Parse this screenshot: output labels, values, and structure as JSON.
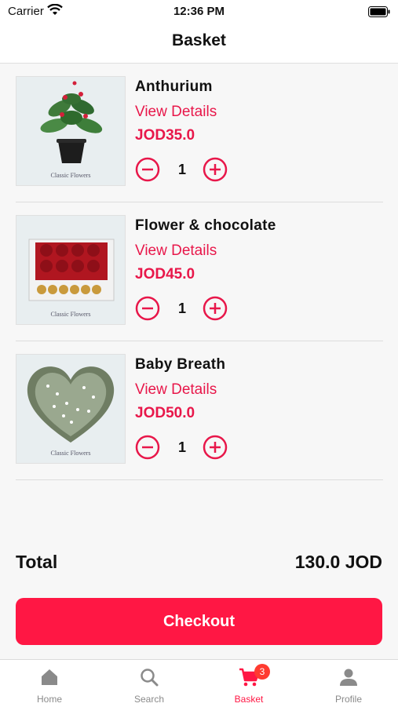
{
  "status": {
    "carrier": "Carrier",
    "time": "12:36 PM"
  },
  "nav": {
    "title": "Basket"
  },
  "items": [
    {
      "name": "Anthurium",
      "details": "View Details",
      "price": "JOD35.0",
      "qty": "1",
      "brand": "Classic Flowers"
    },
    {
      "name": "Flower & chocolate",
      "details": "View Details",
      "price": "JOD45.0",
      "qty": "1",
      "brand": "Classic Flowers"
    },
    {
      "name": "Baby Breath",
      "details": "View Details",
      "price": "JOD50.0",
      "qty": "1",
      "brand": "Classic Flowers"
    }
  ],
  "total": {
    "label": "Total",
    "amount": "130.0 JOD"
  },
  "checkout": {
    "label": "Checkout"
  },
  "tabs": [
    {
      "label": "Home",
      "icon": "home-icon"
    },
    {
      "label": "Search",
      "icon": "search-icon"
    },
    {
      "label": "Basket",
      "icon": "cart-icon",
      "badge": "3",
      "active": true
    },
    {
      "label": "Profile",
      "icon": "profile-icon"
    }
  ],
  "colors": {
    "accent": "#ff1744",
    "text": "#111111",
    "inactive": "#8a8a8a"
  }
}
